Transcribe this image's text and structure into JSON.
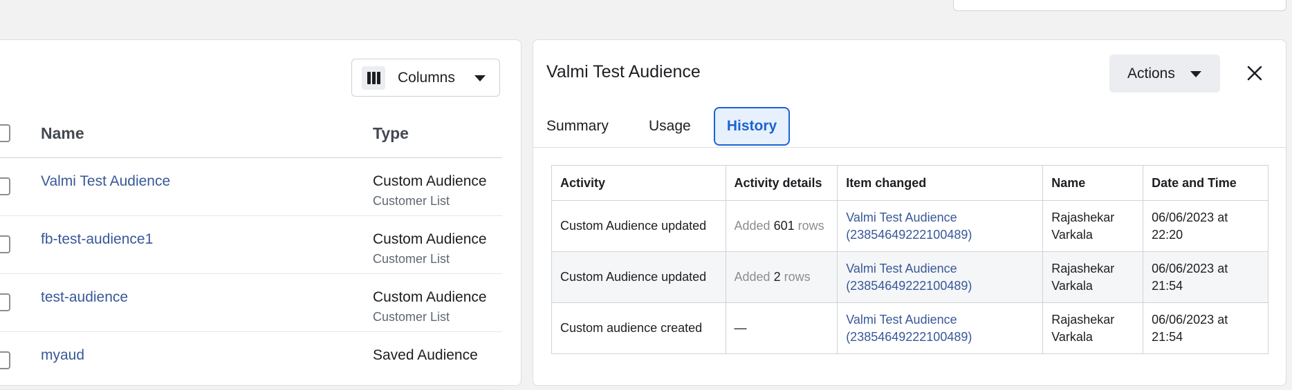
{
  "audience_table": {
    "columns_button": {
      "label": "Columns",
      "icon": "columns-icon"
    },
    "headers": {
      "name": "Name",
      "type": "Type"
    },
    "rows": [
      {
        "name": "Valmi Test Audience",
        "type": "Custom Audience",
        "subtype": "Customer List"
      },
      {
        "name": "fb-test-audience1",
        "type": "Custom Audience",
        "subtype": "Customer List"
      },
      {
        "name": "test-audience",
        "type": "Custom Audience",
        "subtype": "Customer List"
      },
      {
        "name": "myaud",
        "type": "Saved Audience",
        "subtype": ""
      }
    ]
  },
  "detail_panel": {
    "title": "Valmi Test Audience",
    "actions_label": "Actions",
    "tabs": [
      {
        "label": "Summary",
        "active": false
      },
      {
        "label": "Usage",
        "active": false
      },
      {
        "label": "History",
        "active": true
      }
    ],
    "history": {
      "headers": [
        "Activity",
        "Activity details",
        "Item changed",
        "Name",
        "Date and Time"
      ],
      "rows": [
        {
          "activity": "Custom Audience updated",
          "details_prefix": "Added",
          "details_count": "601",
          "details_suffix": "rows",
          "item_changed": "Valmi Test Audience (23854649222100489)",
          "name": "Rajashekar Varkala",
          "datetime": "06/06/2023 at 22:20"
        },
        {
          "activity": "Custom Audience updated",
          "details_prefix": "Added",
          "details_count": "2",
          "details_suffix": "rows",
          "item_changed": "Valmi Test Audience (23854649222100489)",
          "name": "Rajashekar Varkala",
          "datetime": "06/06/2023 at 21:54"
        },
        {
          "activity": "Custom audience created",
          "details_text": "—",
          "item_changed": "Valmi Test Audience (23854649222100489)",
          "name": "Rajashekar Varkala",
          "datetime": "06/06/2023 at 21:54"
        }
      ]
    }
  },
  "colors": {
    "link": "#385898",
    "active_tab": "#1a63d2",
    "active_tab_bg": "#e7f0fd"
  }
}
